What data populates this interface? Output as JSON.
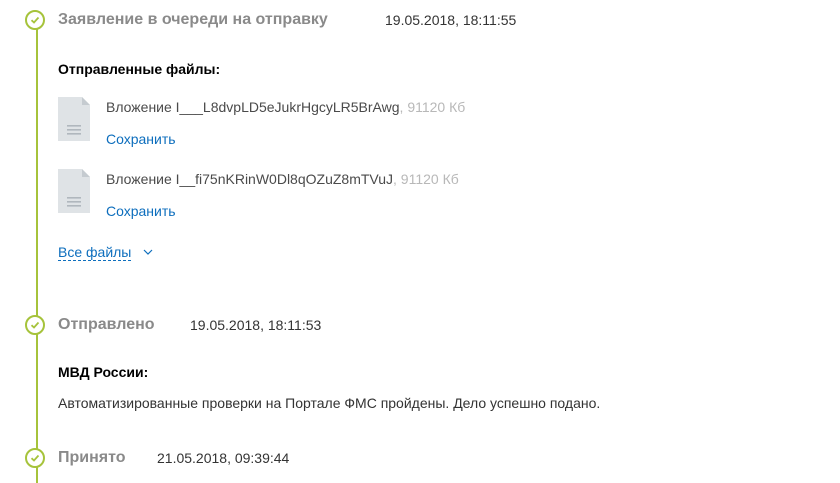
{
  "steps": [
    {
      "title": "Заявление в очереди на отправку",
      "date": "19.05.2018, 18:11:55",
      "icon": "check-icon"
    },
    {
      "title": "Отправлено",
      "date": "19.05.2018, 18:11:53",
      "icon": "check-icon"
    },
    {
      "title": "Принято",
      "date": "21.05.2018, 09:39:44",
      "icon": "check-icon"
    }
  ],
  "sent_files": {
    "heading": "Отправленные файлы:",
    "files": [
      {
        "name": "Вложение I___L8dvpLD5eJukrHgcyLR5BrAwg",
        "size": ", 91120 Кб",
        "save_label": "Сохранить",
        "icon": "document-icon"
      },
      {
        "name": "Вложение I__fi75nKRinW0Dl8qOZuZ8mTVuJ",
        "size": ", 91120 Кб",
        "save_label": "Сохранить",
        "icon": "document-icon"
      }
    ],
    "all_files_label": "Все файлы",
    "all_files_icon": "chevron-down-icon"
  },
  "authority": {
    "heading": "МВД России:",
    "message": "Автоматизированные проверки на Портале ФМС пройдены. Дело успешно подано."
  },
  "colors": {
    "accent_green": "#a6c33b",
    "link_blue": "#0d6ebd",
    "muted_title": "#8a8a8a"
  }
}
